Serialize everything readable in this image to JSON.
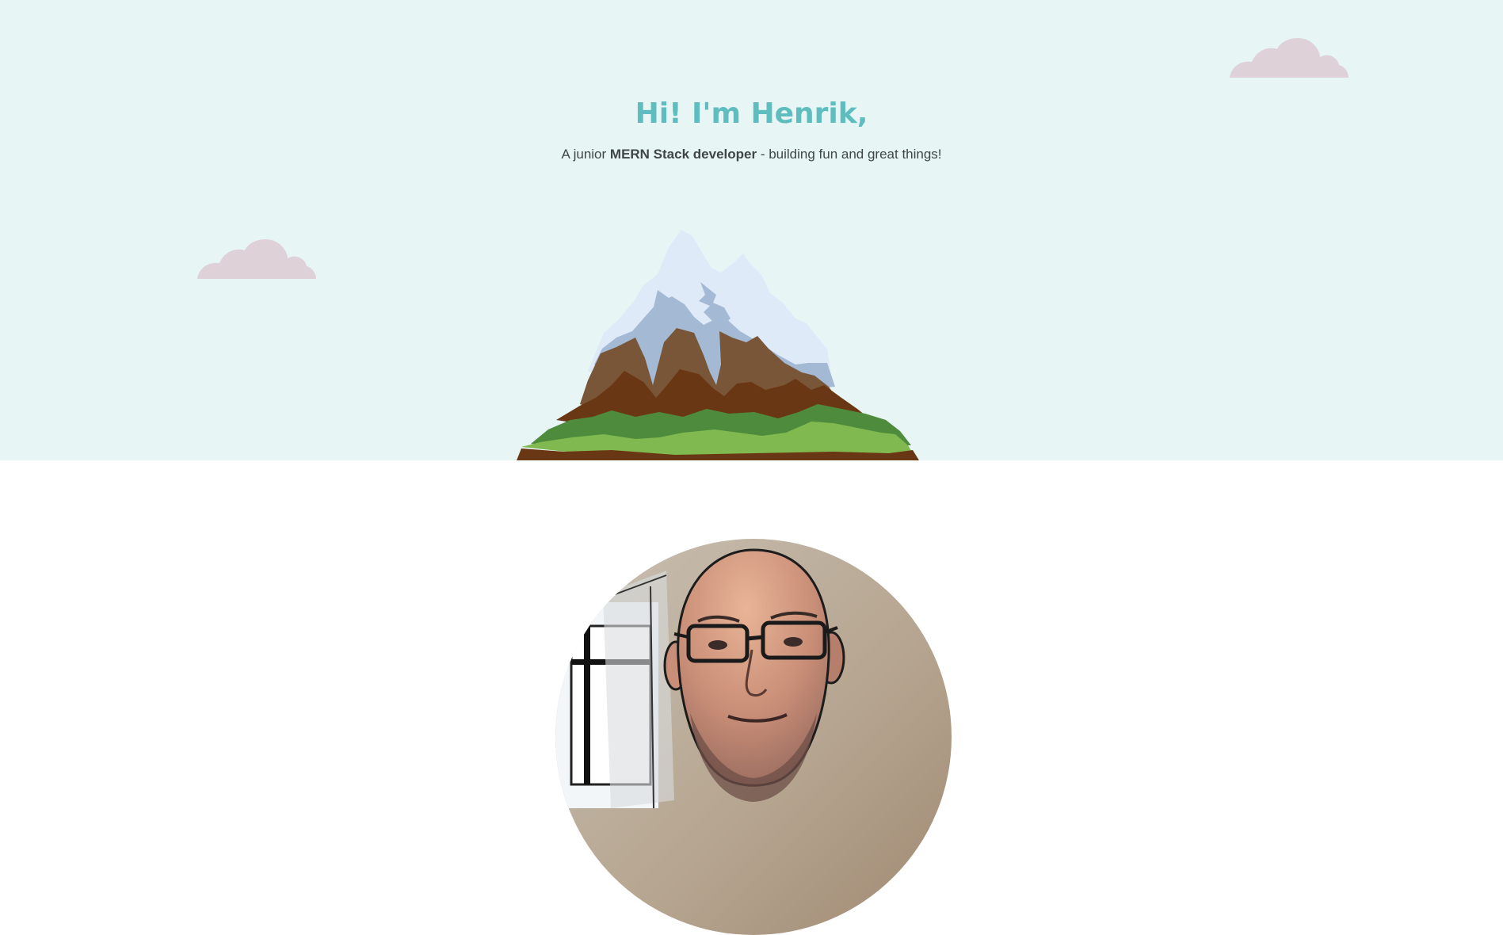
{
  "hero": {
    "title": "Hi! I'm Henrik,",
    "subtitle_pre": "A junior ",
    "subtitle_bold": "MERN Stack developer",
    "subtitle_post": " - building fun and great things!",
    "background_color": "#e7f5f5",
    "title_color": "#5fbcbf"
  },
  "illustrations": {
    "clouds": [
      "cloud-icon",
      "cloud-icon"
    ],
    "mountain": "mountain-illustration"
  },
  "profile": {
    "photo": "avatar"
  }
}
